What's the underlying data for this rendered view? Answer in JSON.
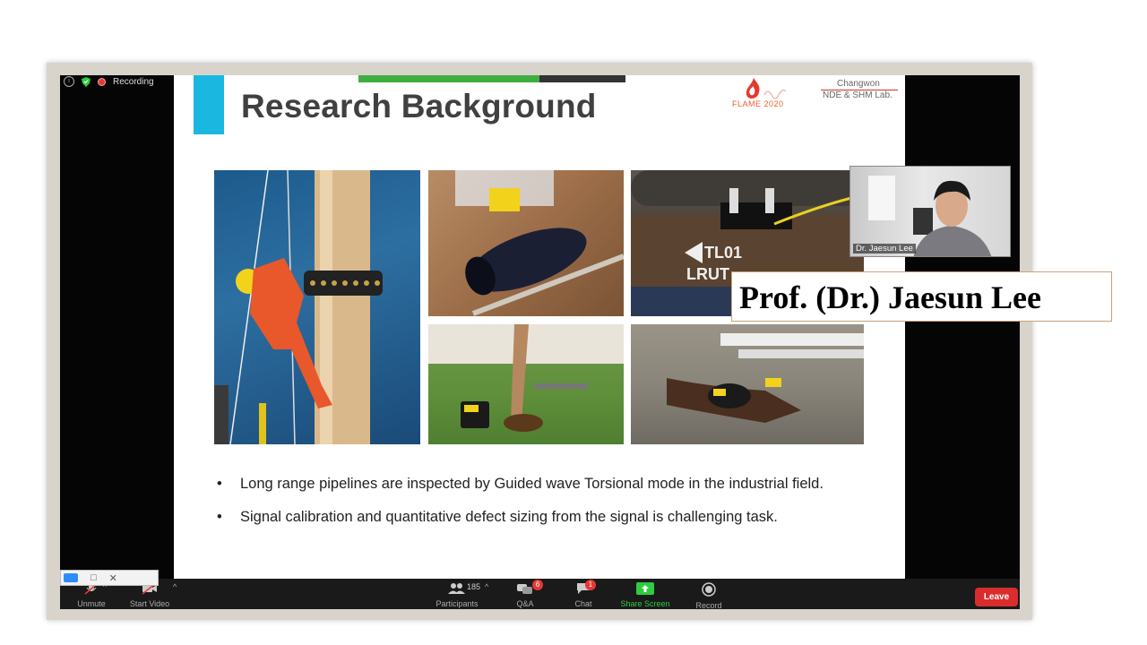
{
  "recording": {
    "label": "Recording"
  },
  "slide": {
    "title": "Research Background",
    "logo_text": "FLAME 2020",
    "lab_line1": "Changwon",
    "lab_line2": "NDE & SHM Lab.",
    "photo_labels": {
      "pipe_marking_1": "TL01",
      "pipe_marking_2": "LRUT"
    },
    "bullets": [
      "Long range pipelines are inspected by Guided wave Torsional mode in the industrial field.",
      "Signal calibration and quantitative defect sizing from the signal is challenging task."
    ]
  },
  "webcam": {
    "name": "Dr. Jaesun Lee"
  },
  "caption": {
    "text": "Prof. (Dr.) Jaesun Lee"
  },
  "toolbar": {
    "unmute": "Unmute",
    "start_video": "Start Video",
    "participants_count": "185",
    "participants": "Participants",
    "qa": "Q&A",
    "qa_badge": "6",
    "chat": "Chat",
    "chat_badge": "1",
    "share_screen": "Share Screen",
    "record": "Record",
    "leave": "Leave"
  },
  "mini_window": {
    "min": "□",
    "close": "✕"
  },
  "colors": {
    "accent": "#1ab7e0",
    "leave": "#d92d2d",
    "share_green": "#3fae3f"
  }
}
